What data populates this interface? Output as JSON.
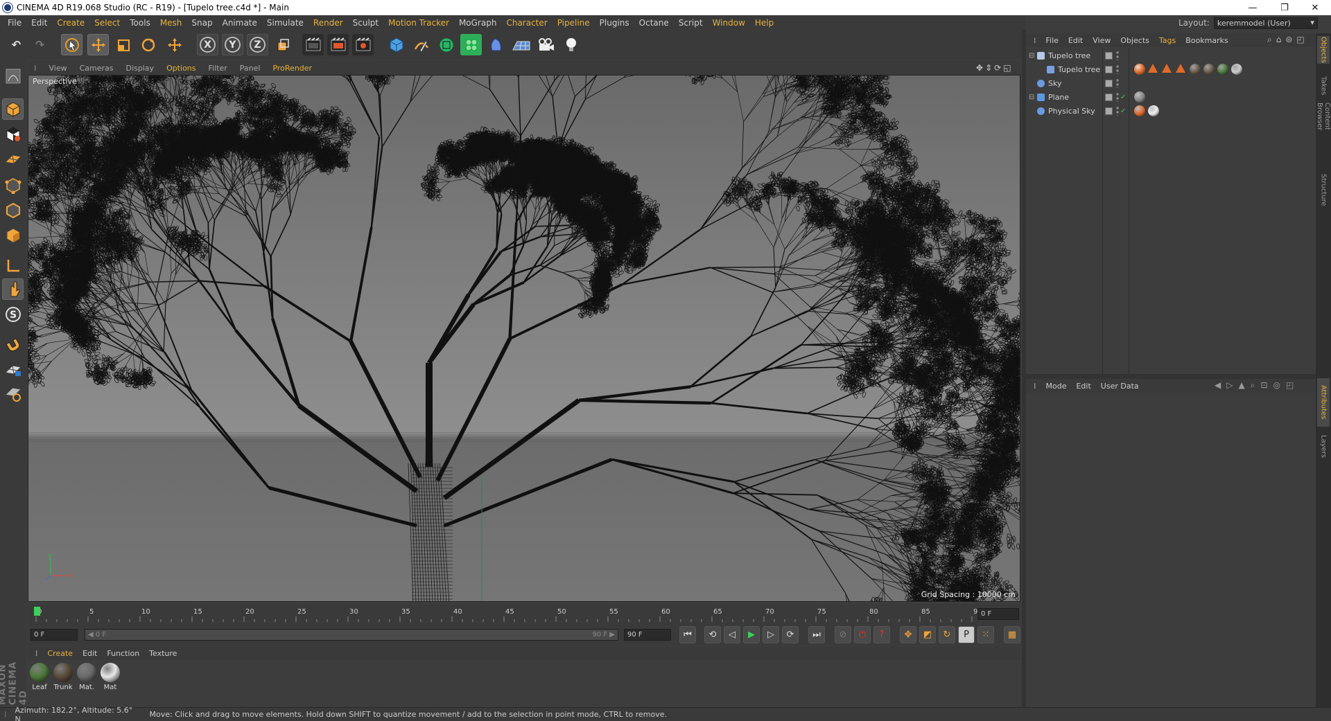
{
  "window": {
    "title": "CINEMA 4D R19.068 Studio (RC - R19) - [Tupelo tree.c4d *] - Main",
    "controls": {
      "minimize": "—",
      "restore": "❐",
      "close": "✕"
    }
  },
  "menubar": {
    "items": [
      "File",
      "Edit",
      "Create",
      "Select",
      "Tools",
      "Mesh",
      "Snap",
      "Animate",
      "Simulate",
      "Render",
      "Sculpt",
      "Motion Tracker",
      "MoGraph",
      "Character",
      "Pipeline",
      "Plugins",
      "Octane",
      "Script",
      "Window",
      "Help"
    ],
    "highlighted": [
      "Create",
      "Select",
      "Mesh",
      "Render",
      "Motion Tracker",
      "Character",
      "Pipeline",
      "Window",
      "Help"
    ]
  },
  "layout": {
    "label": "Layout:",
    "value": "keremmodel (User)"
  },
  "toolbar": {
    "icons": [
      "undo-icon",
      "redo-icon",
      "select-arrow-icon",
      "move-icon",
      "scale-icon",
      "rotate-icon",
      "transform-icon",
      "x-axis-icon",
      "y-axis-icon",
      "z-axis-icon",
      "coordinate-system-icon",
      "render-view-icon",
      "render-picture-viewer-icon",
      "render-settings-icon",
      "cube-icon",
      "pen-icon",
      "subdivision-icon",
      "cloner-icon",
      "deformer-icon",
      "floor-icon",
      "camera-icon",
      "light-icon"
    ],
    "axis_labels": {
      "x": "X",
      "y": "Y",
      "z": "Z"
    }
  },
  "viewport": {
    "menu": [
      "View",
      "Cameras",
      "Display",
      "Options",
      "Filter",
      "Panel",
      "ProRender"
    ],
    "highlighted": [
      "Options",
      "ProRender"
    ],
    "camera_label": "Perspective",
    "grid_spacing": "Grid Spacing : 10000 cm",
    "axis": {
      "x": "x",
      "y": "y"
    }
  },
  "timeline": {
    "ticks": [
      "0",
      "5",
      "10",
      "15",
      "20",
      "25",
      "30",
      "35",
      "40",
      "45",
      "50",
      "55",
      "60",
      "65",
      "70",
      "75",
      "80",
      "85",
      "90"
    ],
    "current_frame_field": "0 F",
    "start_field": "0 F",
    "range_start": "◀ 0 F",
    "range_end": "90 F ▶",
    "end_field": "90 F"
  },
  "material_manager": {
    "menu": [
      "Create",
      "Edit",
      "Function",
      "Texture"
    ],
    "materials": [
      {
        "name": "Leaf",
        "color": "#4e7a3a"
      },
      {
        "name": "Trunk",
        "color": "#5a4a3a"
      },
      {
        "name": "Mat.",
        "color": "#6a6a6a"
      },
      {
        "name": "Mat",
        "color": "#e8e8e8"
      }
    ]
  },
  "brand": {
    "text": "MAXON CINEMA 4D"
  },
  "status": {
    "coords": "Azimuth: 182.2°, Altitude: 5.6°  N",
    "message": "Move: Click and drag to move elements. Hold down SHIFT to quantize movement / add to the selection in point mode, CTRL to remove."
  },
  "object_manager": {
    "menu": [
      "File",
      "Edit",
      "View",
      "Objects",
      "Tags",
      "Bookmarks"
    ],
    "highlighted": [
      "Tags"
    ],
    "objects": [
      {
        "name": "Tupelo tree",
        "indent": 0,
        "icon": "null-icon"
      },
      {
        "name": "Tupelo tree",
        "indent": 1,
        "icon": "bone-icon"
      },
      {
        "name": "Sky",
        "indent": 0,
        "icon": "sky-icon"
      },
      {
        "name": "Plane",
        "indent": 0,
        "icon": "plane-icon"
      },
      {
        "name": "Physical Sky",
        "indent": 0,
        "icon": "physical-sky-icon"
      }
    ]
  },
  "attributes": {
    "menu": [
      "Mode",
      "Edit",
      "User Data"
    ]
  },
  "right_tabs": [
    "Objects",
    "Takes",
    "Content Browser",
    "Structure",
    "Attributes",
    "Layers"
  ],
  "colors": {
    "accent": "#e8b23a",
    "panel": "#3a3a3a",
    "viewport_bg": "#7a7a7a",
    "wire": "#111111"
  }
}
